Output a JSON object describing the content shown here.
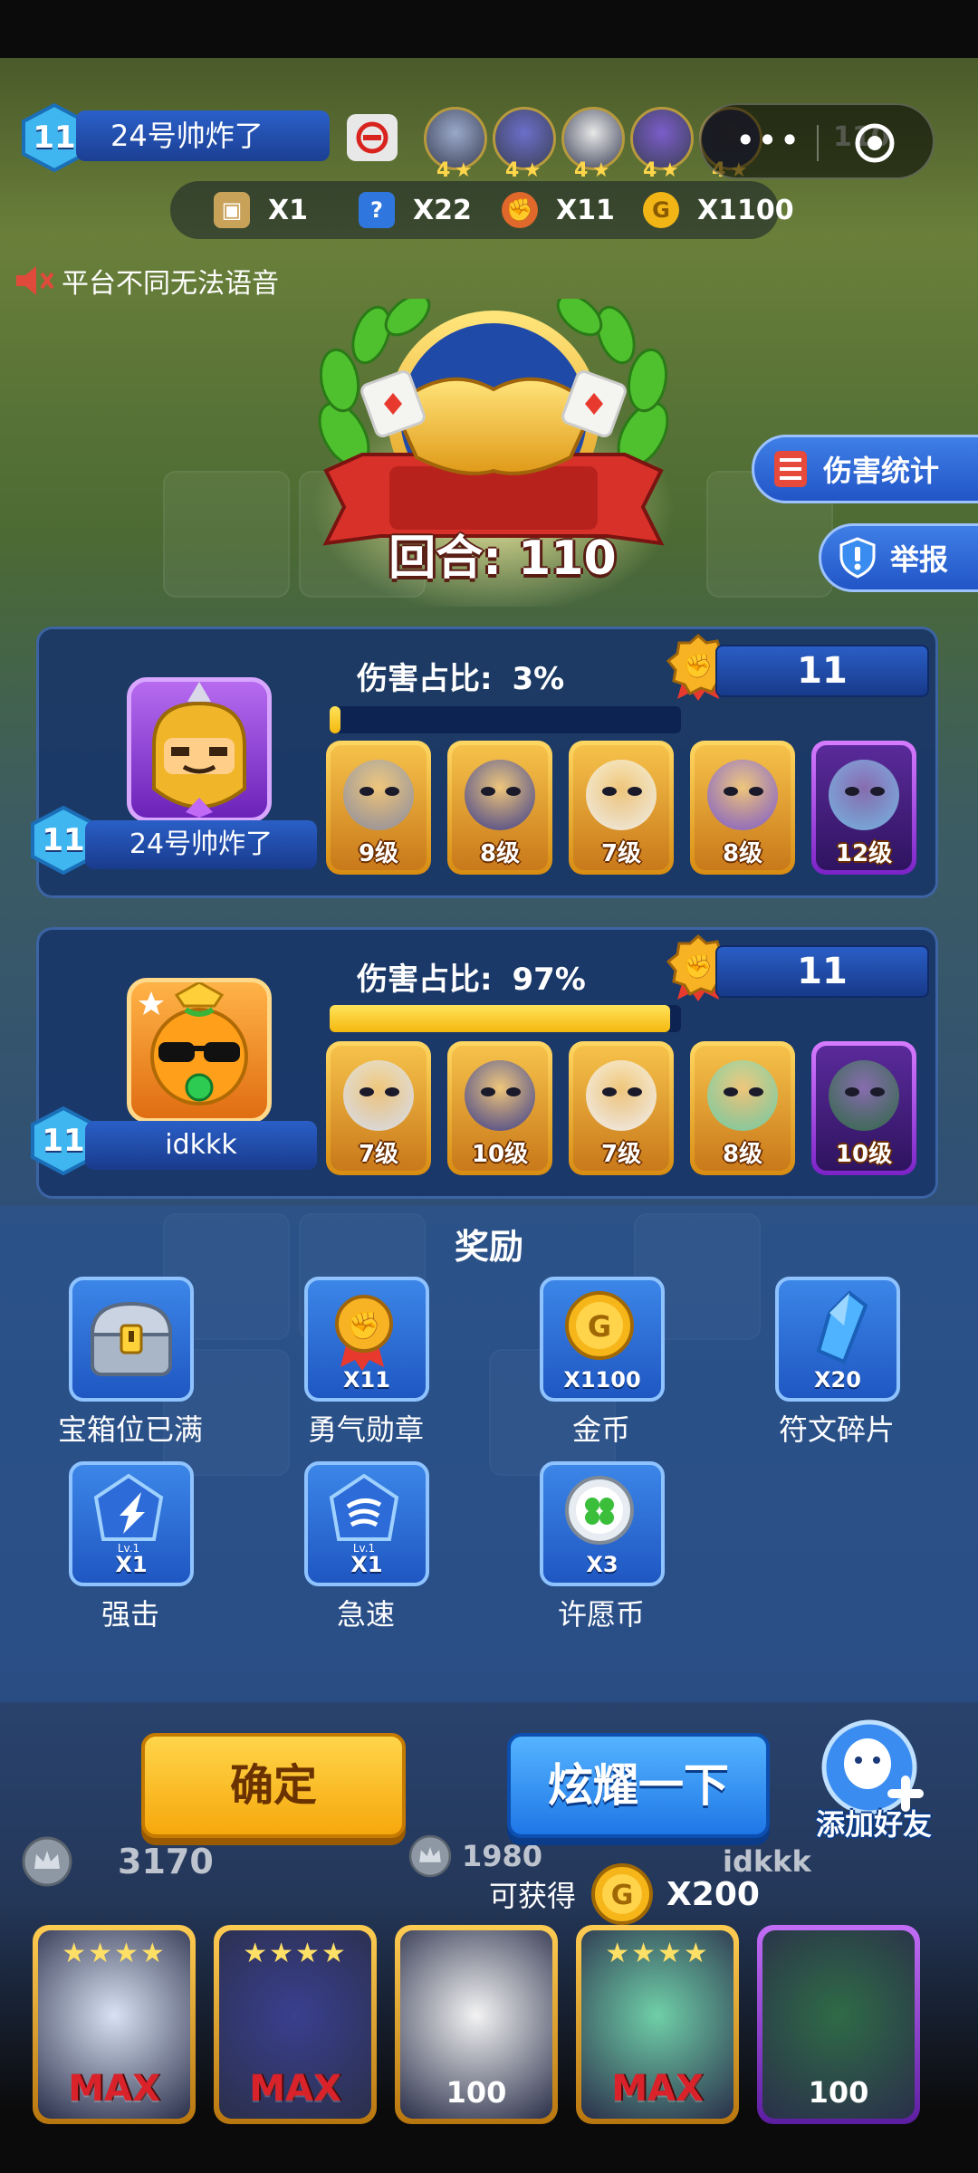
{
  "header": {
    "player_level": "11",
    "player_name": "24号帅炸了",
    "round_top": "110",
    "opponent_units": [
      {
        "stars": "4",
        "color": "#9aa9c9"
      },
      {
        "stars": "4",
        "color": "#6c6fc9"
      },
      {
        "stars": "4",
        "color": "#e8e8e8"
      },
      {
        "stars": "4",
        "color": "#7b5dc9"
      },
      {
        "stars": "4",
        "color": "#3c3c46"
      }
    ],
    "resources": [
      {
        "icon": "treasure-chest-icon",
        "qty": "X1"
      },
      {
        "icon": "question-gem-icon",
        "qty": "X22"
      },
      {
        "icon": "courage-medal-icon",
        "qty": "X11"
      },
      {
        "icon": "gold-coin-icon",
        "qty": "X1100"
      }
    ]
  },
  "voice_notice": "平台不同无法语音",
  "round_banner": "回合: 110",
  "side_buttons": {
    "damage_stats": "伤害统计",
    "report": "举报"
  },
  "players": [
    {
      "level": "11",
      "name": "24号帅炸了",
      "damage_label": "伤害占比:",
      "damage_value": "3%",
      "damage_fraction": 0.03,
      "score": "11",
      "units": [
        {
          "level": "9级",
          "rarity": "legend",
          "color": "#8a8fa3"
        },
        {
          "level": "8级",
          "rarity": "legend",
          "color": "#3a3f8f"
        },
        {
          "level": "7级",
          "rarity": "legend",
          "color": "#f2f2ea"
        },
        {
          "level": "8级",
          "rarity": "legend",
          "color": "#7b5bd1"
        },
        {
          "level": "12级",
          "rarity": "epic",
          "color": "#78b7e6"
        }
      ]
    },
    {
      "level": "11",
      "name": "idkkk",
      "damage_label": "伤害占比:",
      "damage_value": "97%",
      "damage_fraction": 0.97,
      "score": "11",
      "units": [
        {
          "level": "7级",
          "rarity": "legend",
          "color": "#d8e2f3"
        },
        {
          "level": "10级",
          "rarity": "legend",
          "color": "#3a3f8f"
        },
        {
          "level": "7级",
          "rarity": "legend",
          "color": "#f3f3f3"
        },
        {
          "level": "8级",
          "rarity": "legend",
          "color": "#6fcfa8"
        },
        {
          "level": "10级",
          "rarity": "epic",
          "color": "#2f6b46"
        }
      ]
    }
  ],
  "rewards": {
    "title": "奖励",
    "items": [
      {
        "name": "宝箱位已满",
        "qty": "",
        "icon": "treasure-chest-icon"
      },
      {
        "name": "勇气勋章",
        "qty": "X11",
        "icon": "courage-medal-icon"
      },
      {
        "name": "金币",
        "qty": "X1100",
        "icon": "gold-coin-icon"
      },
      {
        "name": "符文碎片",
        "qty": "X20",
        "icon": "rune-shard-icon"
      },
      {
        "name": "强击",
        "qty": "X1",
        "icon": "strike-skill-icon",
        "tag": "Lv.1"
      },
      {
        "name": "急速",
        "qty": "X1",
        "icon": "haste-skill-icon",
        "tag": "Lv.1"
      },
      {
        "name": "许愿币",
        "qty": "X3",
        "icon": "wish-coin-icon"
      }
    ]
  },
  "buttons": {
    "confirm": "确定",
    "show_off": "炫耀一下",
    "add_friend": "添加好友"
  },
  "earn": {
    "label": "可获得",
    "amount": "X200"
  },
  "bottom": {
    "left_crowns": "3170",
    "mid_crowns": "1980",
    "opponent_name": "idkkk",
    "deck": [
      {
        "label": "MAX",
        "stars": "★★★★",
        "color": "#d8e2f3",
        "rarity": "legend"
      },
      {
        "label": "MAX",
        "stars": "★★★★",
        "color": "#3a3f8f",
        "rarity": "legend"
      },
      {
        "label": "100",
        "stars": "",
        "color": "#f3f3f3",
        "rarity": "legend"
      },
      {
        "label": "MAX",
        "stars": "★★★★",
        "color": "#6fcfa8",
        "rarity": "legend"
      },
      {
        "label": "100",
        "stars": "",
        "color": "#2f6b46",
        "rarity": "epic"
      }
    ]
  },
  "colors": {
    "panel": "#173468",
    "accent_gold": "#f4b80e",
    "accent_blue": "#2255c7"
  }
}
